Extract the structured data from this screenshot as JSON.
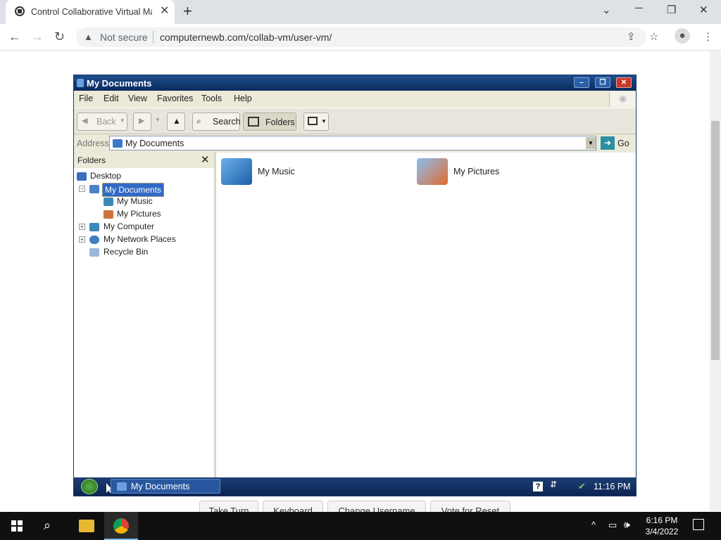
{
  "browser": {
    "tab_title": "Control Collaborative Virtual Ma",
    "new_tab_symbol": "+",
    "security_label": "Not secure",
    "url": "computernewb.com/collab-vm/user-vm/"
  },
  "window": {
    "title": "My Documents",
    "menu": [
      "File",
      "Edit",
      "View",
      "Favorites",
      "Tools",
      "Help"
    ],
    "toolbar": {
      "back": "Back",
      "search": "Search",
      "folders": "Folders"
    },
    "address_label": "Address",
    "address_value": "My Documents",
    "go_label": "Go",
    "folders_pane_title": "Folders",
    "tree": [
      {
        "label": "Desktop"
      },
      {
        "label": "My Documents",
        "selected": true
      },
      {
        "label": "My Music"
      },
      {
        "label": "My Pictures"
      },
      {
        "label": "My Computer"
      },
      {
        "label": "My Network Places"
      },
      {
        "label": "Recycle Bin"
      }
    ],
    "items": [
      {
        "label": "My Music",
        "icon": "music-folder-icon"
      },
      {
        "label": "My Pictures",
        "icon": "pictures-folder-icon"
      }
    ],
    "taskbar_item": "My Documents",
    "clock": "11:16 PM"
  },
  "vm_buttons": [
    "Take Turn",
    "Keyboard",
    "Change Username",
    "Vote for Reset"
  ],
  "host_taskbar": {
    "time": "6:16 PM",
    "date": "3/4/2022"
  },
  "colors": {
    "title_bar": "#0a2a5c",
    "selection": "#316ac5",
    "host_taskbar": "#101010"
  }
}
